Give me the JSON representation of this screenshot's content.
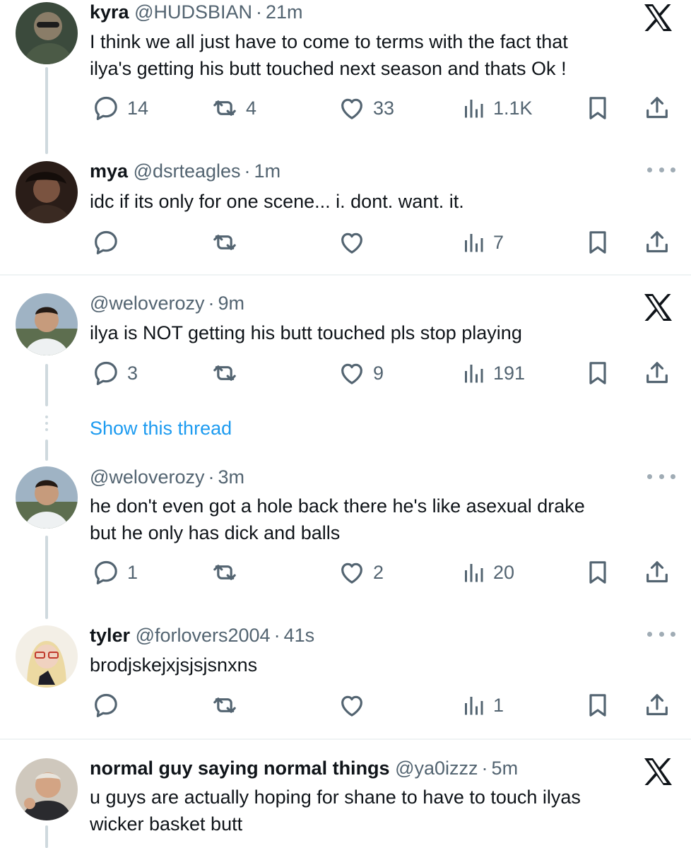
{
  "tweets": [
    {
      "name": "kyra",
      "handle": "@HUDSBIAN",
      "sep": "·",
      "time": "21m",
      "lines": [
        "I think we all just have to come to terms with the fact that",
        "ilya's getting his butt touched next season and thats Ok !"
      ],
      "replies": "14",
      "reposts": "4",
      "likes": "33",
      "views": "1.1K",
      "corner": "x-logo"
    },
    {
      "name": "mya",
      "handle": "@dsrteagles",
      "sep": "·",
      "time": "1m",
      "lines": [
        "idc if its only for one scene... i. dont. want. it."
      ],
      "replies": "",
      "reposts": "",
      "likes": "",
      "views": "7",
      "corner": "more"
    },
    {
      "name": "",
      "handle": "@weloverozy",
      "sep": "·",
      "time": "9m",
      "lines": [
        "ilya is NOT getting his butt touched pls stop playing"
      ],
      "replies": "3",
      "reposts": "",
      "likes": "9",
      "views": "191",
      "corner": "x-logo"
    },
    {
      "name": "",
      "handle": "@weloverozy",
      "sep": "·",
      "time": "3m",
      "lines": [
        "he don't even got a hole back there he's like asexual drake",
        "but he only has dick and balls"
      ],
      "replies": "1",
      "reposts": "",
      "likes": "2",
      "views": "20",
      "corner": "more"
    },
    {
      "name": "tyler",
      "handle": "@forlovers2004",
      "sep": "·",
      "time": "41s",
      "lines": [
        "brodjskejxjsjsjsnxns"
      ],
      "replies": "",
      "reposts": "",
      "likes": "",
      "views": "1",
      "corner": "more"
    },
    {
      "name": "normal guy saying normal things",
      "handle": "@ya0izzz",
      "sep": "·",
      "time": "5m",
      "lines": [
        "u guys are actually hoping for shane to have to touch ilyas",
        "wicker basket butt"
      ],
      "corner": "x-logo"
    }
  ],
  "show_thread": "Show this thread",
  "icons": {
    "reply": "reply-icon",
    "repost": "repost-icon",
    "like": "like-icon",
    "views": "views-icon",
    "bookmark": "bookmark-icon",
    "share": "share-icon",
    "corner_logo": "x-logo-icon",
    "more": "more-icon"
  },
  "colors": {
    "text": "#0f1419",
    "muted": "#536471",
    "link": "#1d9bf0",
    "thread_line": "#cfd9de",
    "divider": "#eff3f4"
  }
}
